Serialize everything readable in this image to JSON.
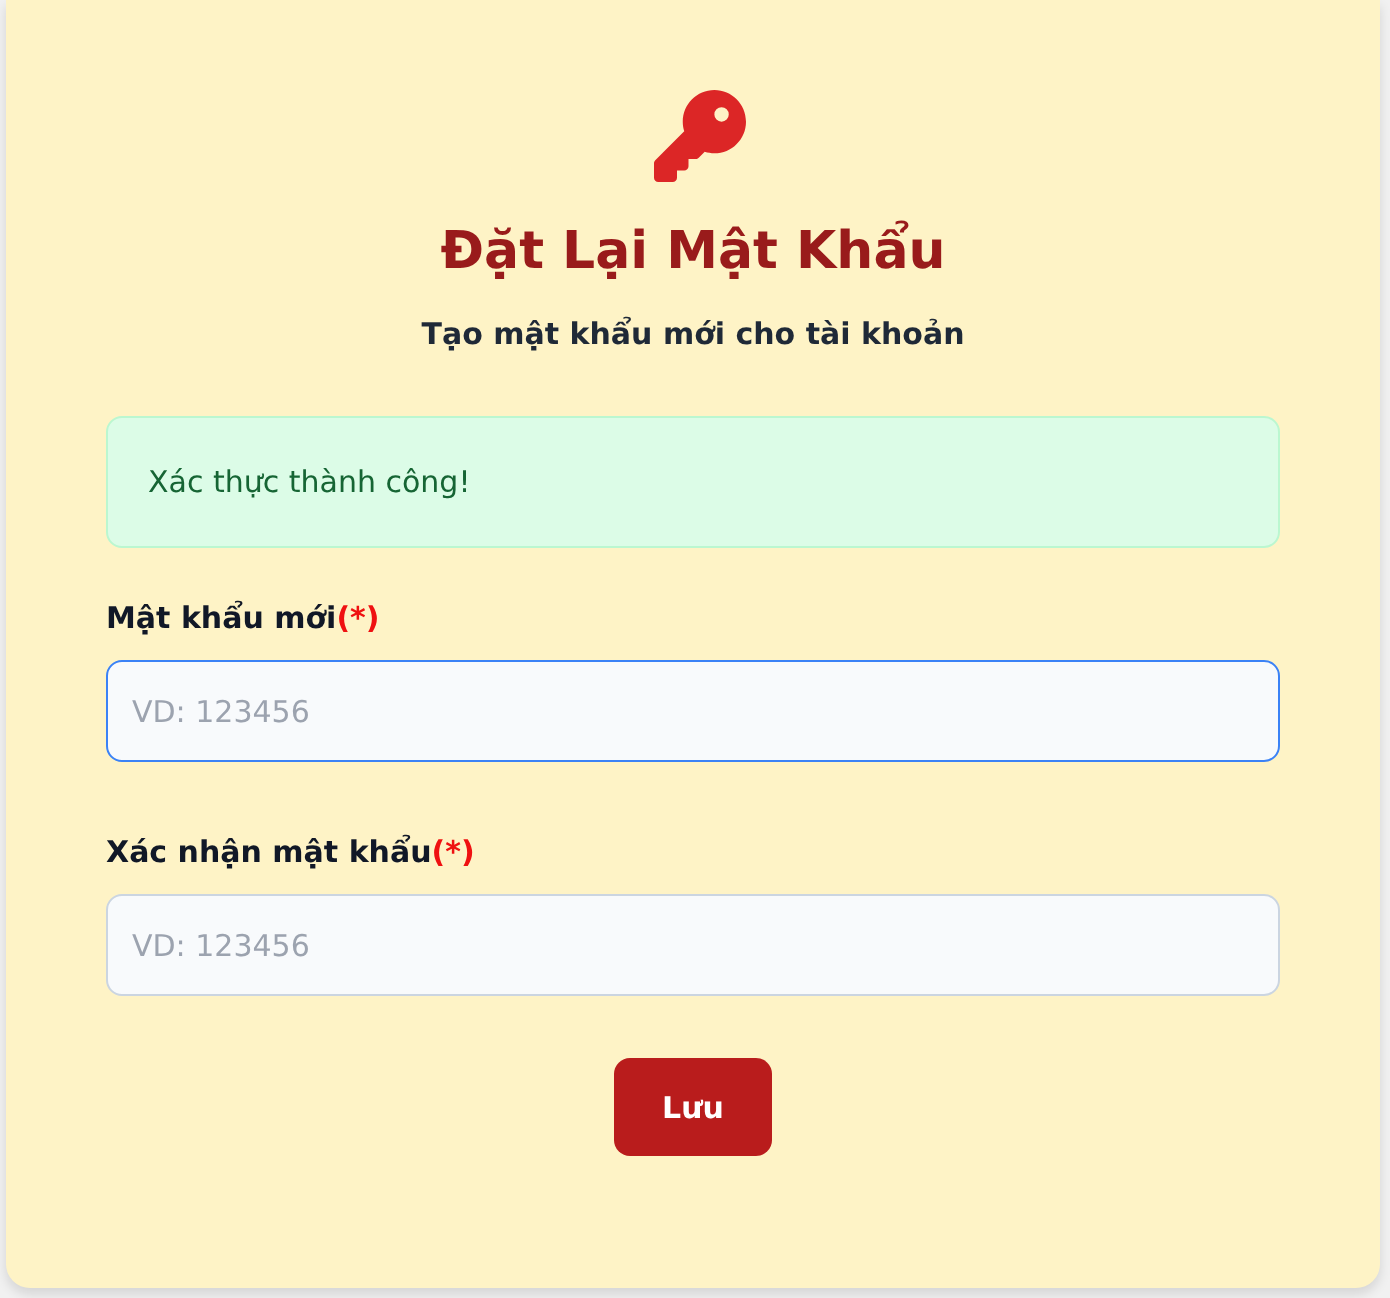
{
  "header": {
    "title": "Đặt Lại Mật Khẩu",
    "subtitle": "Tạo mật khẩu mới cho tài khoản"
  },
  "alert": {
    "kind": "success",
    "text": "Xác thực thành công!"
  },
  "fields": [
    {
      "label": "Mật khẩu mới",
      "required_mark": "(*)",
      "placeholder": "VD: 123456",
      "focused": true
    },
    {
      "label": "Xác nhận mật khẩu",
      "required_mark": "(*)",
      "placeholder": "VD: 123456",
      "focused": false
    }
  ],
  "buttons": [
    {
      "label": "Lưu"
    }
  ]
}
